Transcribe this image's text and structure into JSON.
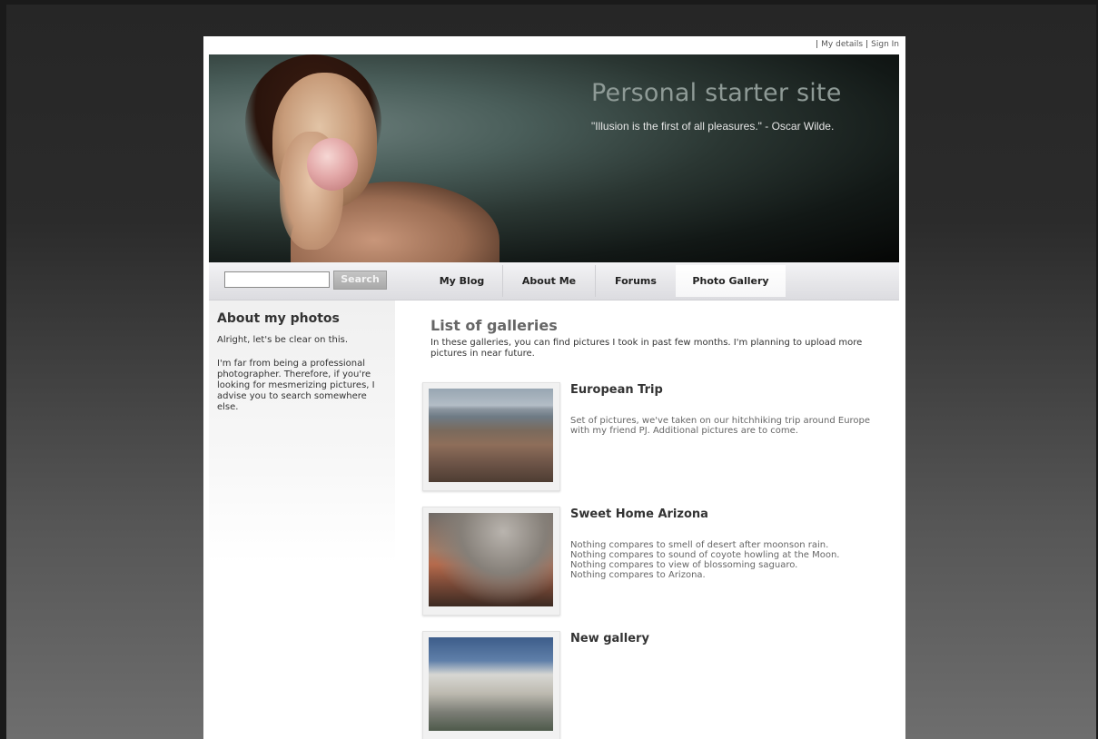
{
  "toplinks": {
    "my_details": "My details",
    "sign_in": "Sign In"
  },
  "banner": {
    "title": "Personal starter site",
    "quote": "\"Illusion is the first of all pleasures.\" - Oscar Wilde."
  },
  "search": {
    "value": "",
    "button_label": "Search"
  },
  "nav": {
    "tabs": [
      {
        "label": "My Blog"
      },
      {
        "label": "About Me"
      },
      {
        "label": "Forums"
      },
      {
        "label": "Photo Gallery",
        "active": true
      }
    ]
  },
  "sidebar": {
    "heading": "About my photos",
    "p1": "Alright, let's be clear on this.",
    "p2": "I'm far from being a professional photographer. Therefore, if you're looking for mesmerizing pictures, I advise you to search somewhere else."
  },
  "main": {
    "heading": "List of galleries",
    "intro": "In these galleries, you can find pictures I took in past few months. I'm planning to upload more pictures in near future.",
    "galleries": [
      {
        "title": "European Trip",
        "description": "Set of pictures, we've taken on our hitchhiking trip around Europe with my friend PJ. Additional pictures are to come."
      },
      {
        "title": "Sweet Home Arizona",
        "description_lines": [
          "Nothing compares to smell of desert after moonson rain.",
          "Nothing compares to sound of coyote howling at the Moon.",
          "Nothing compares to view of blossoming saguaro.",
          "Nothing compares to Arizona."
        ]
      },
      {
        "title": "New gallery",
        "description": ""
      }
    ]
  }
}
